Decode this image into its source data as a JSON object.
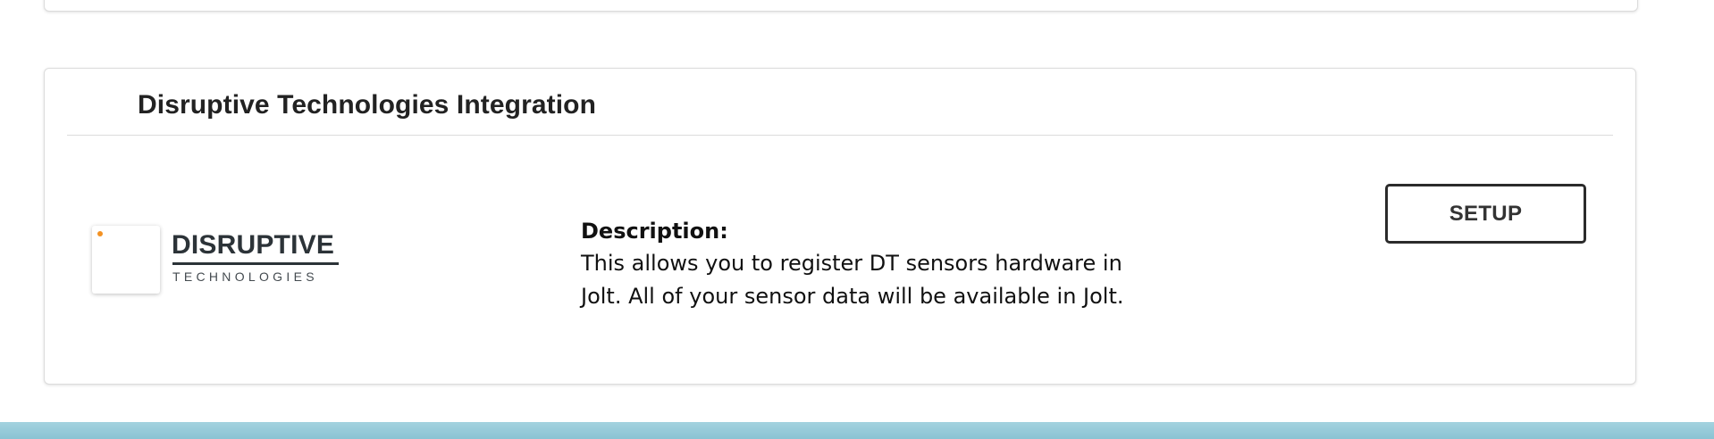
{
  "integration": {
    "title": "Disruptive Technologies Integration",
    "logo": {
      "word": "DISRUPTIVE",
      "sub": "TECHNOLOGIES",
      "dot_color": "#f39224",
      "text_color": "#2c3338"
    },
    "description_label": "Description:",
    "description_text": "This allows you to register DT sensors hardware in Jolt. All of your sensor data will be available in Jolt.",
    "setup_label": "SETUP"
  },
  "colors": {
    "footer_band": "#8ac3d3",
    "card_border": "#dcdcdc",
    "button_border": "#2b2b2b"
  }
}
